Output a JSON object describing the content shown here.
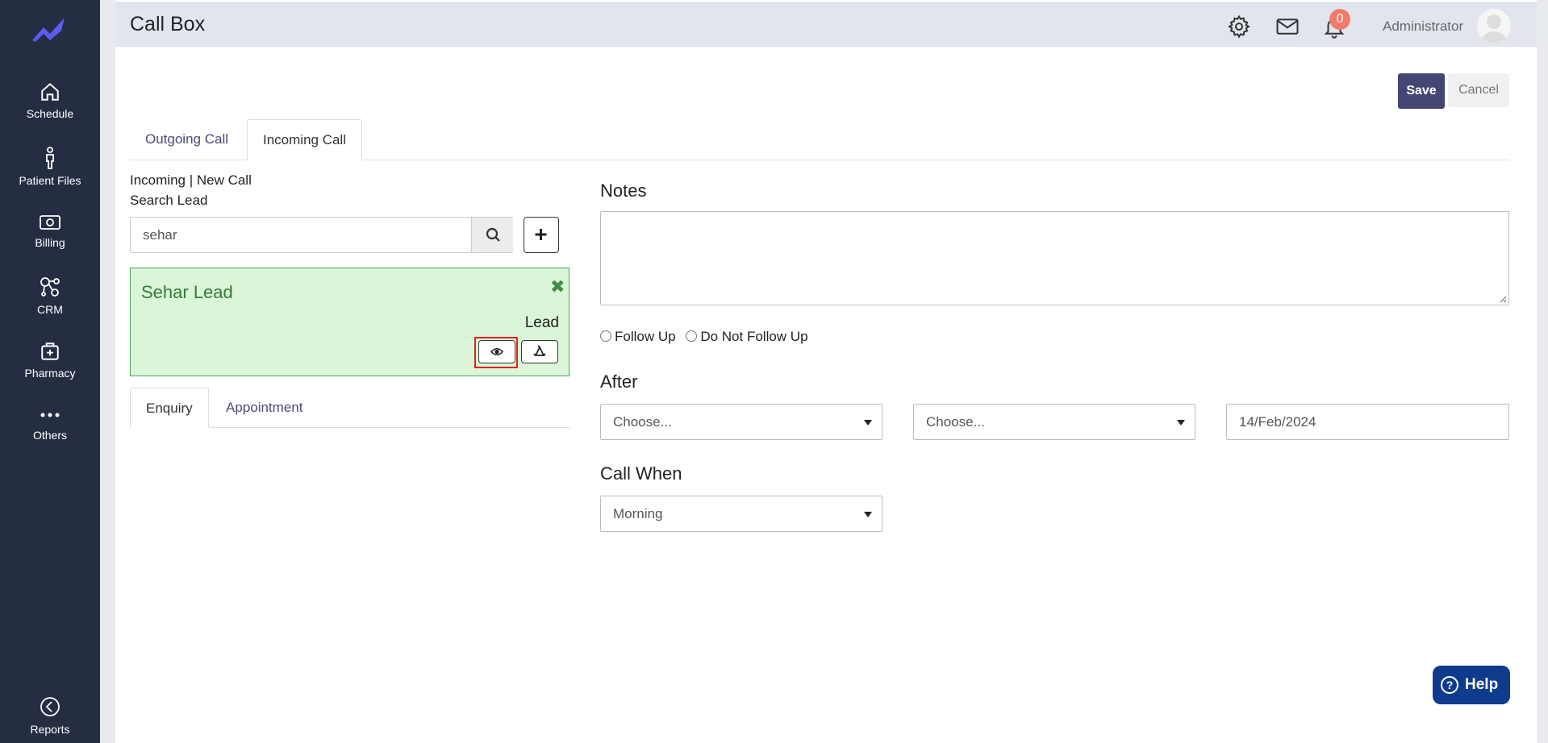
{
  "sidebar": {
    "items": [
      {
        "label": "Schedule"
      },
      {
        "label": "Patient Files"
      },
      {
        "label": "Billing"
      },
      {
        "label": "CRM"
      },
      {
        "label": "Pharmacy"
      },
      {
        "label": "Others"
      }
    ],
    "bottom": {
      "label": "Reports"
    }
  },
  "header": {
    "title": "Call Box",
    "notification_count": "0",
    "user_name": "Administrator"
  },
  "actions": {
    "save_label": "Save",
    "cancel_label": "Cancel"
  },
  "tabs": [
    {
      "label": "Outgoing Call"
    },
    {
      "label": "Incoming Call",
      "active": true
    }
  ],
  "left": {
    "status_text": "Incoming | New Call",
    "search_label": "Search Lead",
    "search_value": "sehar",
    "lead": {
      "name": "Sehar Lead",
      "type": "Lead"
    },
    "subtabs": [
      {
        "label": "Enquiry",
        "active": true
      },
      {
        "label": "Appointment"
      }
    ]
  },
  "right": {
    "notes_label": "Notes",
    "follow_up_label": "Follow Up",
    "no_follow_up_label": "Do Not Follow Up",
    "after_label": "After",
    "after_select1": "Choose...",
    "after_select2": "Choose...",
    "after_date": "14/Feb/2024",
    "call_when_label": "Call When",
    "call_when_value": "Morning"
  },
  "help": {
    "label": "Help"
  },
  "colors": {
    "sidebar": "#252d42",
    "accent": "#454674",
    "lead_bg": "#daf5d7",
    "help": "#0e3b8c"
  }
}
